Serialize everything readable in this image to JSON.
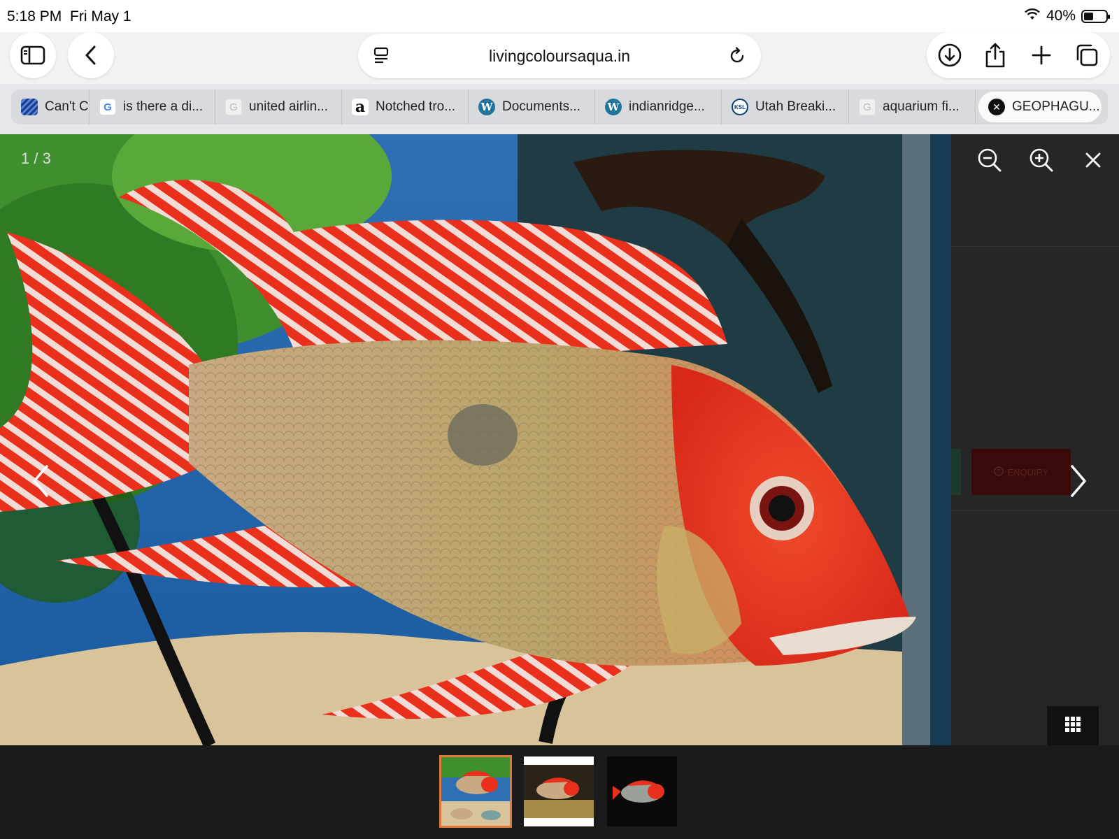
{
  "status_bar": {
    "time": "5:18 PM",
    "date": "Fri May 1",
    "battery": "40%",
    "wifi_icon": "wifi-icon",
    "battery_icon": "battery-icon"
  },
  "toolbar": {
    "url": "livingcoloursaqua.in",
    "icons": [
      "sidebar-icon",
      "back-icon",
      "page-menu-icon",
      "reload-icon",
      "download-icon",
      "share-icon",
      "new-tab-icon",
      "tabs-overview-icon"
    ]
  },
  "tabs": [
    {
      "label": "Can't C",
      "favicon": "united-favicon"
    },
    {
      "label": "is there a di...",
      "favicon": "google-favicon"
    },
    {
      "label": "united airlin...",
      "favicon": "google-gray-favicon"
    },
    {
      "label": "Notched tro...",
      "favicon": "amazon-favicon"
    },
    {
      "label": "Documents...",
      "favicon": "wordpress-favicon"
    },
    {
      "label": "indianridge...",
      "favicon": "wordpress-favicon"
    },
    {
      "label": "Utah Breaki...",
      "favicon": "ksl-favicon"
    },
    {
      "label": "aquarium fi...",
      "favicon": "google-gray-favicon"
    },
    {
      "label": "GEOPHAGU...",
      "favicon": "close-favicon",
      "active": true
    }
  ],
  "favicon_glyphs": {
    "google": "G",
    "amazon": "a",
    "wordpress": "W",
    "ksl": "KSL",
    "close": "✕"
  },
  "lightbox": {
    "counter": "1 / 3",
    "enquiry_label": "ENQUIRY",
    "icons": [
      "zoom-out-icon",
      "zoom-in-icon",
      "close-icon",
      "prev-arrow-icon",
      "next-arrow-icon",
      "grid-icon"
    ],
    "thumbnail_count": 3,
    "selected_thumbnail": 1
  },
  "colors": {
    "accent": "#e07a3a",
    "lightbox_bg": "#1b1b1b",
    "fish_red": "#e8301c"
  }
}
